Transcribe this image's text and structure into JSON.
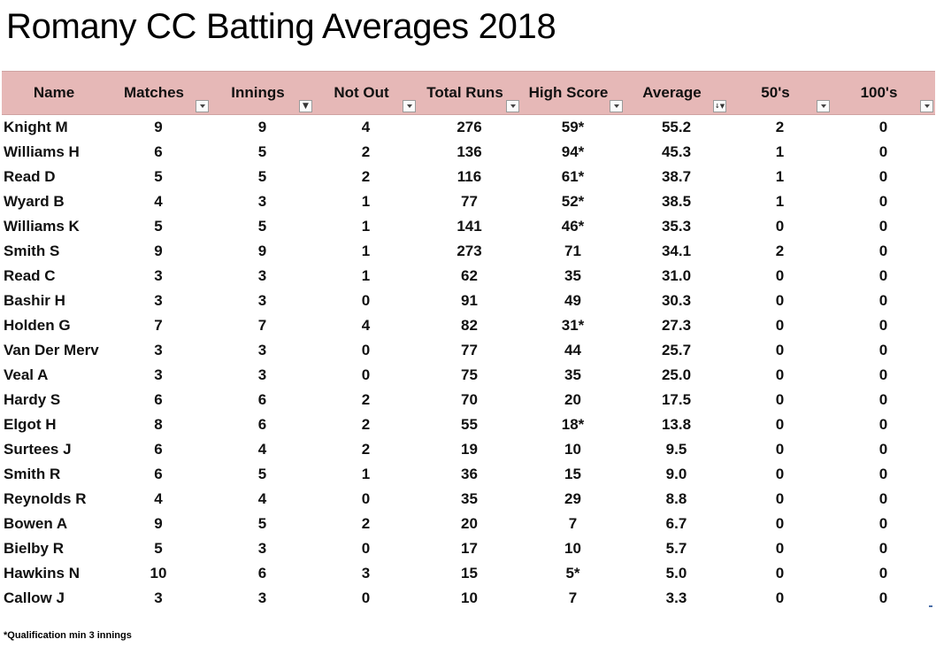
{
  "title": "Romany CC Batting Averages 2018",
  "headers": [
    {
      "label": "Name",
      "filter": "none"
    },
    {
      "label": "Matches",
      "filter": "dropdown"
    },
    {
      "label": "Innings",
      "filter": "filtered"
    },
    {
      "label": "Not Out",
      "filter": "dropdown"
    },
    {
      "label": "Total Runs",
      "filter": "dropdown"
    },
    {
      "label": "High Score",
      "filter": "dropdown"
    },
    {
      "label": "Average",
      "filter": "sorted-filtered"
    },
    {
      "label": "50's",
      "filter": "dropdown"
    },
    {
      "label": "100's",
      "filter": "dropdown"
    }
  ],
  "rows": [
    [
      "Knight M",
      "9",
      "9",
      "4",
      "276",
      "59*",
      "55.2",
      "2",
      "0"
    ],
    [
      "Williams H",
      "6",
      "5",
      "2",
      "136",
      "94*",
      "45.3",
      "1",
      "0"
    ],
    [
      "Read D",
      "5",
      "5",
      "2",
      "116",
      "61*",
      "38.7",
      "1",
      "0"
    ],
    [
      "Wyard B",
      "4",
      "3",
      "1",
      "77",
      "52*",
      "38.5",
      "1",
      "0"
    ],
    [
      "Williams K",
      "5",
      "5",
      "1",
      "141",
      "46*",
      "35.3",
      "0",
      "0"
    ],
    [
      "Smith S",
      "9",
      "9",
      "1",
      "273",
      "71",
      "34.1",
      "2",
      "0"
    ],
    [
      "Read C",
      "3",
      "3",
      "1",
      "62",
      "35",
      "31.0",
      "0",
      "0"
    ],
    [
      "Bashir H",
      "3",
      "3",
      "0",
      "91",
      "49",
      "30.3",
      "0",
      "0"
    ],
    [
      "Holden G",
      "7",
      "7",
      "4",
      "82",
      "31*",
      "27.3",
      "0",
      "0"
    ],
    [
      "Van Der Merv",
      "3",
      "3",
      "0",
      "77",
      "44",
      "25.7",
      "0",
      "0"
    ],
    [
      "Veal A",
      "3",
      "3",
      "0",
      "75",
      "35",
      "25.0",
      "0",
      "0"
    ],
    [
      "Hardy S",
      "6",
      "6",
      "2",
      "70",
      "20",
      "17.5",
      "0",
      "0"
    ],
    [
      "Elgot H",
      "8",
      "6",
      "2",
      "55",
      "18*",
      "13.8",
      "0",
      "0"
    ],
    [
      "Surtees J",
      "6",
      "4",
      "2",
      "19",
      "10",
      "9.5",
      "0",
      "0"
    ],
    [
      "Smith R",
      "6",
      "5",
      "1",
      "36",
      "15",
      "9.0",
      "0",
      "0"
    ],
    [
      "Reynolds R",
      "4",
      "4",
      "0",
      "35",
      "29",
      "8.8",
      "0",
      "0"
    ],
    [
      "Bowen A",
      "9",
      "5",
      "2",
      "20",
      "7",
      "6.7",
      "0",
      "0"
    ],
    [
      "Bielby R",
      "5",
      "3",
      "0",
      "17",
      "10",
      "5.7",
      "0",
      "0"
    ],
    [
      "Hawkins N",
      "10",
      "6",
      "3",
      "15",
      "5*",
      "5.0",
      "0",
      "0"
    ],
    [
      "Callow J",
      "3",
      "3",
      "0",
      "10",
      "7",
      "3.3",
      "0",
      "0"
    ]
  ],
  "footnote": "*Qualification min 3 innings",
  "colors": {
    "header_bg": "#e6b8b7"
  }
}
